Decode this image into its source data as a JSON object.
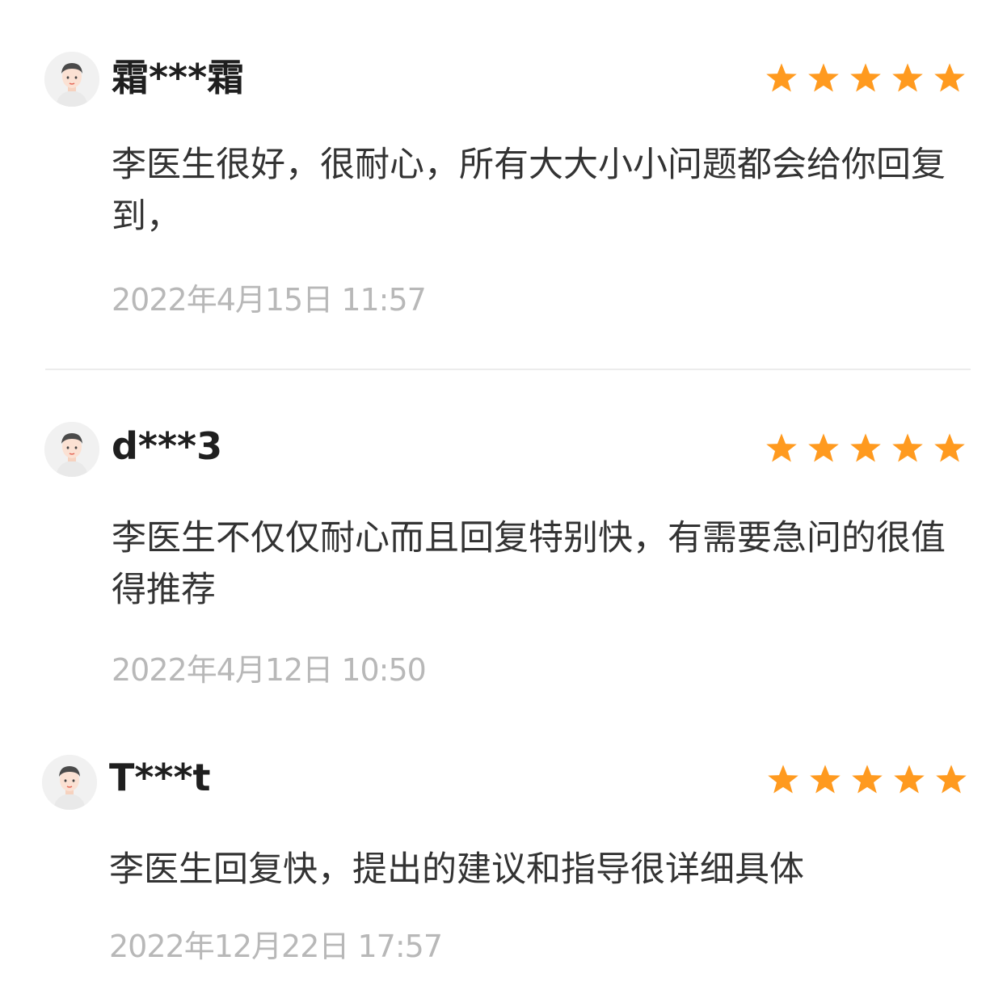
{
  "reviews": [
    {
      "username": "霜***霜",
      "rating": 5,
      "content": "李医生很好，很耐心，所有大大小小问题都会给你回复到，",
      "time": "2022年4月15日 11:57"
    },
    {
      "username": "d***3",
      "rating": 5,
      "content": "李医生不仅仅耐心而且回复特别快，有需要急问的很值得推荐",
      "time": "2022年4月12日 10:50"
    },
    {
      "username": "T***t",
      "rating": 5,
      "content": "李医生回复快，提出的建议和指导很详细具体",
      "time": "2022年12月22日 17:57"
    }
  ],
  "colors": {
    "star": "#ff9a1f",
    "username": "#1f1f1f",
    "content": "#333333",
    "time": "#b8b8b8",
    "divider": "#ececec"
  },
  "icons": {
    "avatar": "user-avatar-icon",
    "star": "star-icon"
  }
}
